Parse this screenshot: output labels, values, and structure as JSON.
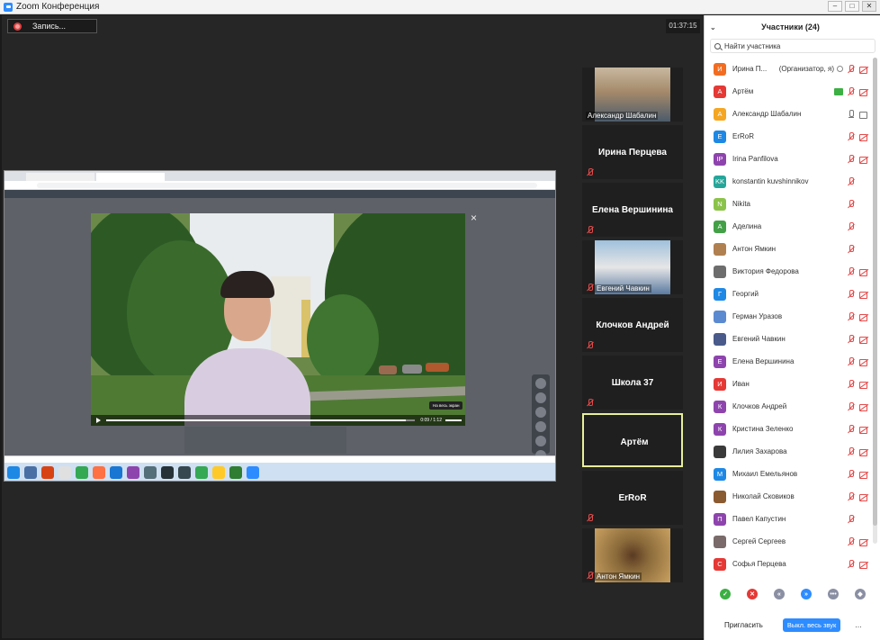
{
  "window": {
    "title": "Zoom Конференция"
  },
  "main": {
    "record_label": "Запись...",
    "timer": "01:37:15"
  },
  "shared_screen": {
    "tooltip": "На весь экран",
    "video_time": "0:09 / 1:12"
  },
  "gallery": [
    {
      "name": "Александр Шабалин",
      "type": "photo",
      "muted": false
    },
    {
      "name": "Ирина Перцева",
      "type": "name",
      "muted": true
    },
    {
      "name": "Елена  Вершинина",
      "type": "name",
      "muted": true
    },
    {
      "name": "Евгений Чавкин",
      "type": "photo",
      "muted": true
    },
    {
      "name": "Клочков Андрей",
      "type": "name",
      "muted": true
    },
    {
      "name": "Школа 37",
      "type": "name",
      "muted": true
    },
    {
      "name": "Артём",
      "type": "name",
      "muted": false,
      "active": true
    },
    {
      "name": "ErRoR",
      "type": "name",
      "muted": true
    },
    {
      "name": "Антон Ямкин",
      "type": "photo",
      "muted": true
    }
  ],
  "participants_panel": {
    "title": "Участники (24)",
    "search_placeholder": "Найти участника",
    "participants": [
      {
        "initial": "И",
        "color": "#f26d21",
        "name": "Ирина П...",
        "role": "(Организатор, я)",
        "mic": "off",
        "cam": "off",
        "host": true
      },
      {
        "initial": "А",
        "color": "#e53935",
        "name": "Артём",
        "mic": "off",
        "cam": "off",
        "sharing": true
      },
      {
        "initial": "А",
        "color": "#f5a623",
        "name": "Александр Шабалин",
        "mic": "on",
        "cam": "on"
      },
      {
        "initial": "E",
        "color": "#1e88e5",
        "name": "ErRoR",
        "mic": "off",
        "cam": "off"
      },
      {
        "initial": "IP",
        "color": "#8e44ad",
        "name": "Irina Panfilova",
        "mic": "off",
        "cam": "off"
      },
      {
        "initial": "KK",
        "color": "#26a69a",
        "name": "konstantin kuvshinnikov",
        "mic": "off",
        "cam": "none"
      },
      {
        "initial": "N",
        "color": "#8bc34a",
        "name": "Nikita",
        "mic": "off",
        "cam": "none"
      },
      {
        "initial": "А",
        "color": "#43a047",
        "name": "Аделина",
        "mic": "off",
        "cam": "none"
      },
      {
        "initial": "",
        "color": "#b08050",
        "name": "Антон Ямкин",
        "mic": "off",
        "cam": "none"
      },
      {
        "initial": "",
        "color": "#6d6d6d",
        "name": "Виктория Федорова",
        "mic": "off",
        "cam": "off"
      },
      {
        "initial": "Г",
        "color": "#1e88e5",
        "name": "Георгий",
        "mic": "off",
        "cam": "off"
      },
      {
        "initial": "",
        "color": "#5c8ad1",
        "name": "Герман Уразов",
        "mic": "off",
        "cam": "off"
      },
      {
        "initial": "",
        "color": "#4a5a8a",
        "name": "Евгений Чавкин",
        "mic": "off",
        "cam": "off"
      },
      {
        "initial": "Е",
        "color": "#8e44ad",
        "name": "Елена Вершинина",
        "mic": "off",
        "cam": "off"
      },
      {
        "initial": "И",
        "color": "#e53935",
        "name": "Иван",
        "mic": "off",
        "cam": "off"
      },
      {
        "initial": "К",
        "color": "#8e44ad",
        "name": "Клочков Андрей",
        "mic": "off",
        "cam": "off"
      },
      {
        "initial": "К",
        "color": "#8e44ad",
        "name": "Кристина Зеленко",
        "mic": "off",
        "cam": "off"
      },
      {
        "initial": "",
        "color": "#3a3a3a",
        "name": "Лилия Захарова",
        "mic": "off",
        "cam": "off"
      },
      {
        "initial": "М",
        "color": "#1e88e5",
        "name": "Михаил Емельянов",
        "mic": "off",
        "cam": "off"
      },
      {
        "initial": "",
        "color": "#8a5a30",
        "name": "Николай Сковиков",
        "mic": "off",
        "cam": "off"
      },
      {
        "initial": "П",
        "color": "#8e44ad",
        "name": "Павел Капустин",
        "mic": "off",
        "cam": "none"
      },
      {
        "initial": "",
        "color": "#7a6a6a",
        "name": "Сергей Сергеев",
        "mic": "off",
        "cam": "off"
      },
      {
        "initial": "С",
        "color": "#e53935",
        "name": "Софья Перцева",
        "mic": "off",
        "cam": "off"
      }
    ],
    "reactions": [
      {
        "icon": "check-icon",
        "glyph": "✓",
        "color": "#3cb043"
      },
      {
        "icon": "x-icon",
        "glyph": "✕",
        "color": "#e53935"
      },
      {
        "icon": "slower-icon",
        "glyph": "«",
        "color": "#8a8fa3"
      },
      {
        "icon": "faster-icon",
        "glyph": "»",
        "color": "#2d8cff"
      },
      {
        "icon": "more-reactions-icon",
        "glyph": "•••",
        "color": "#8a8fa3"
      },
      {
        "icon": "clear-icon",
        "glyph": "◆",
        "color": "#8a8fa3"
      }
    ],
    "invite_label": "Пригласить",
    "mute_all_label": "Выкл. весь звук",
    "more_label": "..."
  }
}
